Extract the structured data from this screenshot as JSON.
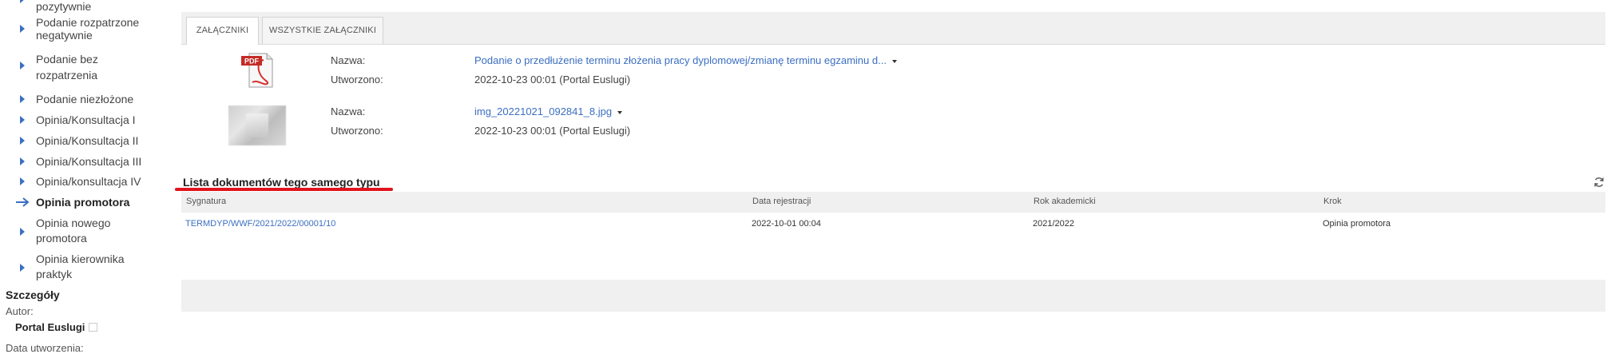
{
  "sidebar": {
    "items": [
      {
        "label_lines": [
          "pozytywnie"
        ]
      },
      {
        "label_lines": [
          "Podanie rozpatrzone",
          "negatywnie"
        ]
      },
      {
        "label_lines": [
          "Podanie bez",
          "rozpatrzenia"
        ]
      },
      {
        "label_lines": [
          "Podanie niezłożone"
        ]
      },
      {
        "label_lines": [
          "Opinia/Konsultacja I"
        ]
      },
      {
        "label_lines": [
          "Opinia/Konsultacja II"
        ]
      },
      {
        "label_lines": [
          "Opinia/Konsultacja III"
        ]
      },
      {
        "label_lines": [
          "Opinia/konsultacja IV"
        ]
      },
      {
        "label_lines": [
          "Opinia promotora"
        ],
        "active": true
      },
      {
        "label_lines": [
          "Opinia nowego",
          "promotora"
        ]
      },
      {
        "label_lines": [
          "Opinia kierownika",
          "praktyk"
        ]
      }
    ],
    "details": {
      "title": "Szczegóły",
      "author_label": "Autor:",
      "author_value": "Portal Euslugi",
      "created_label": "Data utworzenia:"
    }
  },
  "tabs": [
    {
      "label": "ZAŁĄCZNIKI",
      "active": true
    },
    {
      "label": "WSZYSTKIE ZAŁĄCZNIKI",
      "active": false
    }
  ],
  "attachments": [
    {
      "icon": "pdf-file-icon",
      "name_label": "Nazwa:",
      "name": "Podanie o przedłużenie terminu złożenia pracy dyplomowej/zmianę terminu egzaminu d...",
      "created_label": "Utworzono:",
      "created": "2022-10-23 00:01 (Portal Euslugi)"
    },
    {
      "icon": "image-thumbnail",
      "name_label": "Nazwa:",
      "name": "img_20221021_092841_8.jpg",
      "created_label": "Utworzono:",
      "created": "2022-10-23 00:01 (Portal Euslugi)"
    }
  ],
  "documents": {
    "title": "Lista dokumentów tego samego typu",
    "columns": [
      "Sygnatura",
      "Data rejestracji",
      "Rok akademicki",
      "Krok"
    ],
    "rows": [
      [
        "TERMDYP/WWF/2021/2022/00001/10",
        "2022-10-01 00:04",
        "2021/2022",
        "Opinia promotora"
      ]
    ]
  },
  "colors": {
    "accent": "#3b6fc0",
    "highlight_underline": "#e0141e",
    "panel_bg": "#f0f0f0"
  }
}
